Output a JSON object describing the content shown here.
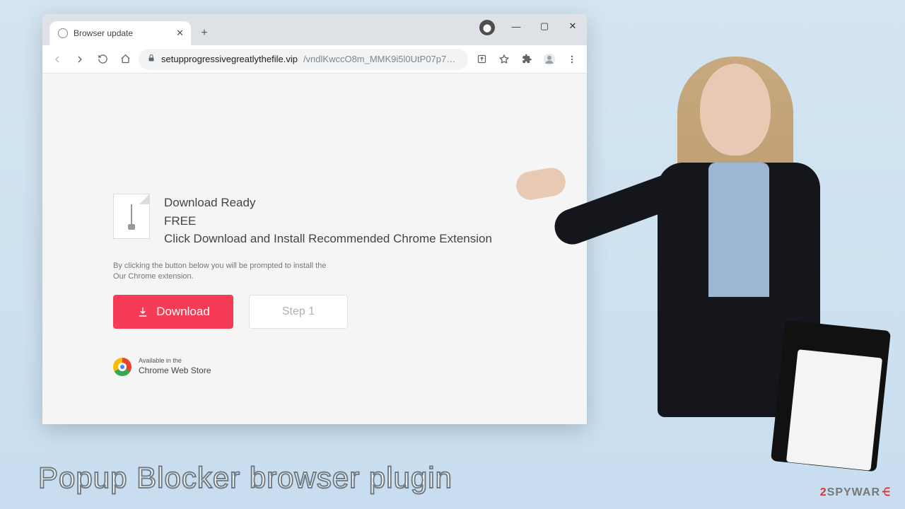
{
  "window": {
    "tab_title": "Browser update",
    "buttons": {
      "minimize": "—",
      "maximize": "▢",
      "close": "✕"
    }
  },
  "toolbar": {
    "url_host": "setupprogressivegreatlythefile.vip",
    "url_path": "/vndlKwccO8m_MMK9i5l0UtP07p79EuN7dxh9cIVc_00..."
  },
  "page": {
    "heading1": "Download Ready",
    "heading2": "FREE",
    "heading3": "Click Download and Install Recommended Chrome Extension",
    "disclaimer_l1": "By clicking the button below you will be prompted to install the",
    "disclaimer_l2": "Our Chrome extension.",
    "download_label": "Download",
    "step_label": "Step 1",
    "store_small": "Available in the",
    "store_name": "Chrome Web Store"
  },
  "caption": "Popup Blocker browser plugin",
  "watermark": {
    "prefix": "2",
    "mid": "SPYWAR",
    "suffix": "⋲"
  },
  "colors": {
    "accent": "#f63b55",
    "bg": "#d4e5f1"
  }
}
